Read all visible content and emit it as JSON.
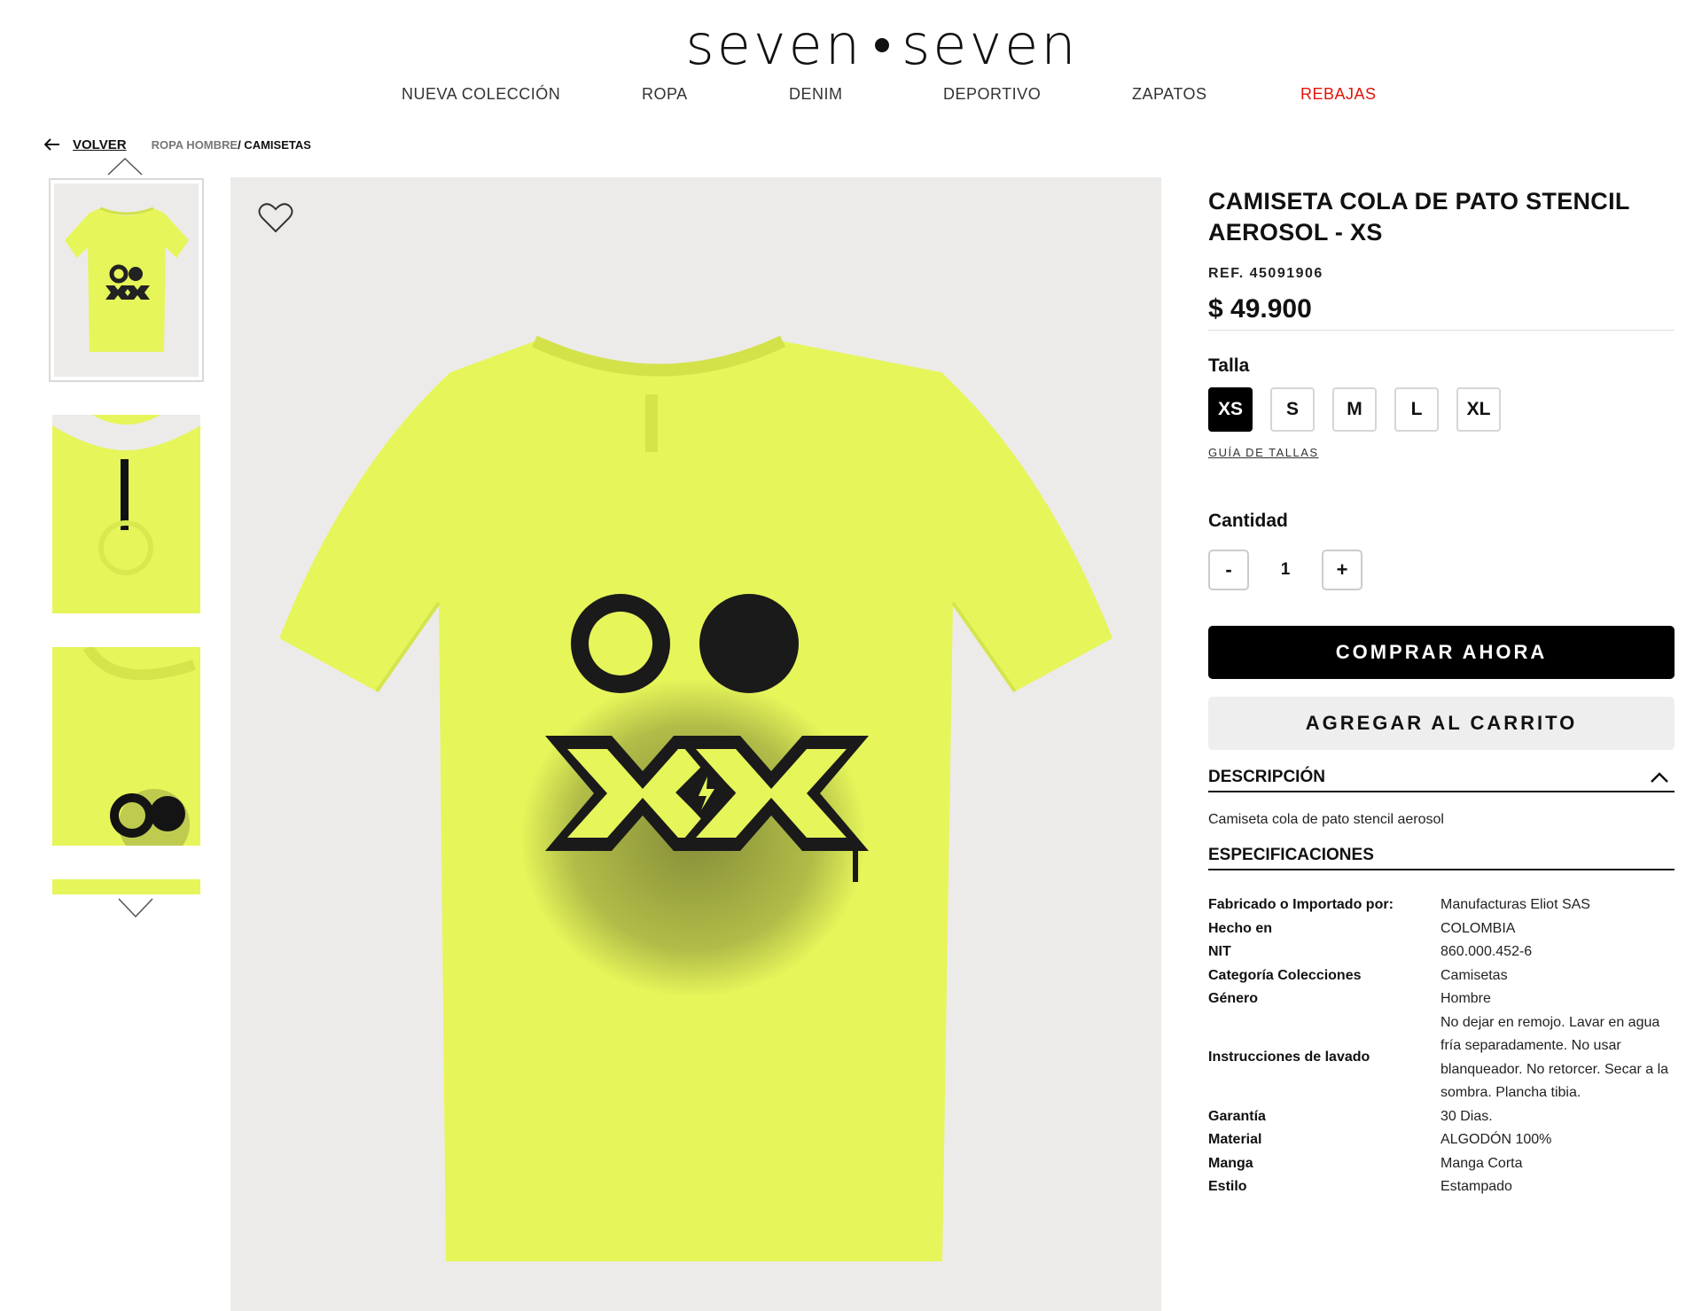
{
  "brand": {
    "left": "seven",
    "right": "seven"
  },
  "nav": [
    {
      "label": "NUEVA COLECCIÓN"
    },
    {
      "label": "ROPA"
    },
    {
      "label": "DENIM"
    },
    {
      "label": "DEPORTIVO"
    },
    {
      "label": "ZAPATOS"
    },
    {
      "label": "REBAJAS"
    }
  ],
  "colors": {
    "sale": "#e1140a",
    "product": "#e6f55a",
    "image_bg": "#ecebe9"
  },
  "breadcrumb": {
    "back": "VOLVER",
    "section": "ROPA HOMBRE",
    "current": "/ CAMISETAS"
  },
  "gallery": {
    "thumbnail_count": 4,
    "selected_index": 0
  },
  "product": {
    "title": "CAMISETA COLA DE PATO STENCIL AEROSOL - XS",
    "ref": "REF. 45091906",
    "price": "$ 49.900",
    "size_label": "Talla",
    "sizes": [
      "XS",
      "S",
      "M",
      "L",
      "XL"
    ],
    "selected_size": "XS",
    "size_guide": "GUÍA DE TALLAS",
    "quantity_label": "Cantidad",
    "qty_minus": "-",
    "quantity": "1",
    "qty_plus": "+",
    "buy_now": "COMPRAR AHORA",
    "add_to_cart": "AGREGAR AL CARRITO"
  },
  "description": {
    "heading": "DESCRIPCIÓN",
    "text": "Camiseta cola de pato stencil aerosol"
  },
  "specifications": {
    "heading": "ESPECIFICACIONES",
    "rows": [
      {
        "k": "Fabricado o Importado por:",
        "v": "Manufacturas Eliot SAS"
      },
      {
        "k": "Hecho en",
        "v": "COLOMBIA"
      },
      {
        "k": "NIT",
        "v": "860.000.452-6"
      },
      {
        "k": "Categoría Colecciones",
        "v": "Camisetas"
      },
      {
        "k": "Género",
        "v": "Hombre"
      },
      {
        "k": "Instrucciones de lavado",
        "v": "No dejar en remojo. Lavar en agua fría separadamente. No usar blanqueador. No retorcer. Secar a la sombra. Plancha tibia."
      },
      {
        "k": "Garantía",
        "v": "30 Dias."
      },
      {
        "k": "Material",
        "v": "ALGODÓN 100%"
      },
      {
        "k": "Manga",
        "v": "Manga Corta"
      },
      {
        "k": "Estilo",
        "v": "Estampado"
      }
    ]
  }
}
